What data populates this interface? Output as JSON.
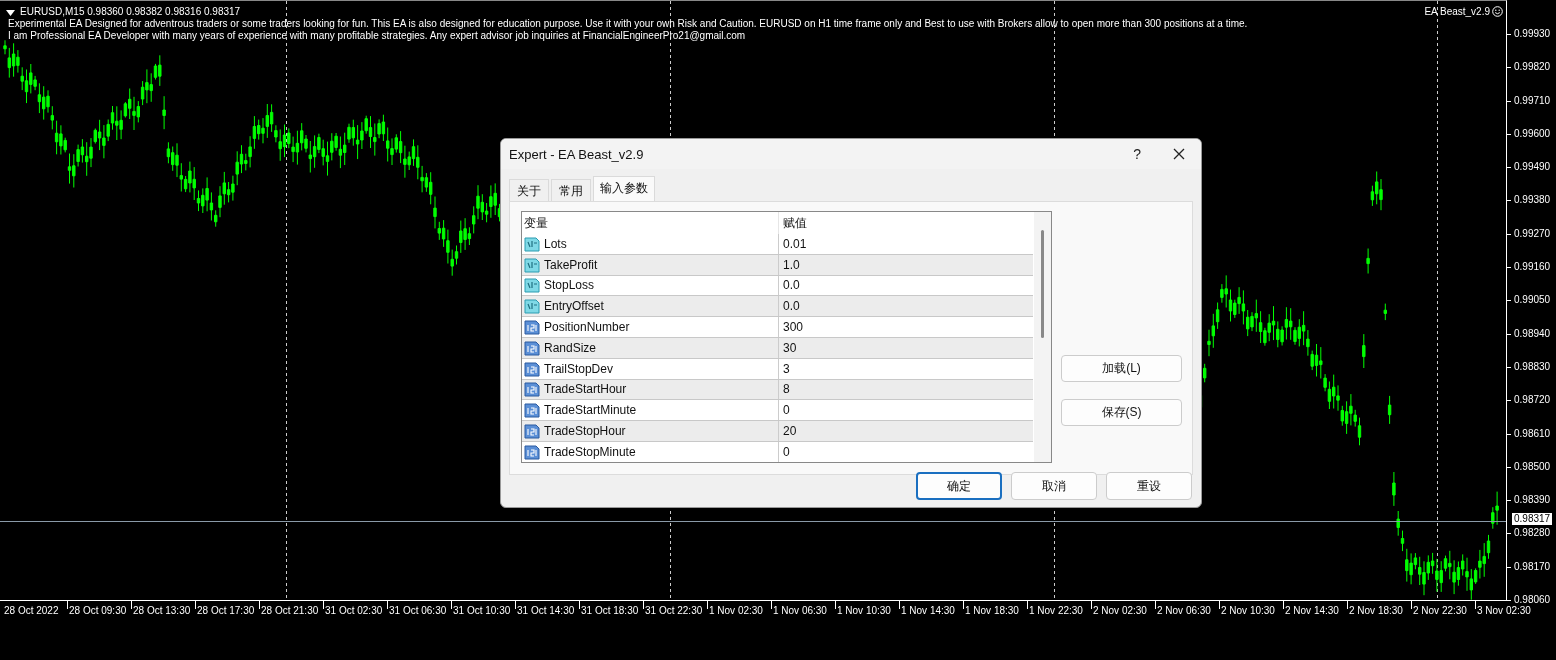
{
  "chart": {
    "symbol_line": "EURUSD,M15  0.98360 0.98382 0.98316 0.98317",
    "comments": [
      "Experimental EA Designed for adventrous traders or some traders looking for fun. This EA is also designed for education purpose. Use it with your own Risk and Caution. EURUSD on H1 time frame only and Best to use with Brokers allow to open more than 300 positions at a time.",
      "I am Professional EA Developer with many years of experience with many profitable strategies. Any expert advisor job inquiries at FinancialEngineerPro21@gmail.com"
    ],
    "expert_name": "EA Beast_v2.9",
    "price_axis": [
      "0.99930",
      "0.99820",
      "0.99710",
      "0.99600",
      "0.99490",
      "0.99380",
      "0.99270",
      "0.99160",
      "0.99050",
      "0.98940",
      "0.98830",
      "0.98720",
      "0.98610",
      "0.98500",
      "0.98390",
      "0.98280",
      "0.98170",
      "0.98060"
    ],
    "current_price": "0.98317",
    "time_axis": [
      "28 Oct 2022",
      "28 Oct 09:30",
      "28 Oct 13:30",
      "28 Oct 17:30",
      "28 Oct 21:30",
      "31 Oct 02:30",
      "31 Oct 06:30",
      "31 Oct 10:30",
      "31 Oct 14:30",
      "31 Oct 18:30",
      "31 Oct 22:30",
      "1 Nov 02:30",
      "1 Nov 06:30",
      "1 Nov 10:30",
      "1 Nov 14:30",
      "1 Nov 18:30",
      "1 Nov 22:30",
      "2 Nov 02:30",
      "2 Nov 06:30",
      "2 Nov 10:30",
      "2 Nov 14:30",
      "2 Nov 18:30",
      "2 Nov 22:30",
      "3 Nov 02:30"
    ]
  },
  "dialog": {
    "title": "Expert - EA Beast_v2.9",
    "help": "?",
    "tabs": [
      {
        "label": "关于",
        "selected": false
      },
      {
        "label": "常用",
        "selected": false
      },
      {
        "label": "输入参数",
        "selected": true
      }
    ],
    "columns": [
      "变量",
      "赋值"
    ],
    "rows": [
      {
        "kind": "double",
        "name": "Lots",
        "value": "0.01"
      },
      {
        "kind": "double",
        "name": "TakeProfit",
        "value": "1.0"
      },
      {
        "kind": "double",
        "name": "StopLoss",
        "value": "0.0"
      },
      {
        "kind": "double",
        "name": "EntryOffset",
        "value": "0.0"
      },
      {
        "kind": "int",
        "name": "PositionNumber",
        "value": "300"
      },
      {
        "kind": "int",
        "name": "RandSize",
        "value": "30"
      },
      {
        "kind": "int",
        "name": "TrailStopDev",
        "value": "3"
      },
      {
        "kind": "int",
        "name": "TradeStartHour",
        "value": "8"
      },
      {
        "kind": "int",
        "name": "TradeStartMinute",
        "value": "0"
      },
      {
        "kind": "int",
        "name": "TradeStopHour",
        "value": "20"
      },
      {
        "kind": "int",
        "name": "TradeStopMinute",
        "value": "0"
      }
    ],
    "side_buttons": [
      "加载(L)",
      "保存(S)"
    ],
    "buttons": [
      {
        "label": "确定",
        "default": true
      },
      {
        "label": "取消",
        "default": false
      },
      {
        "label": "重设",
        "default": false
      }
    ]
  }
}
